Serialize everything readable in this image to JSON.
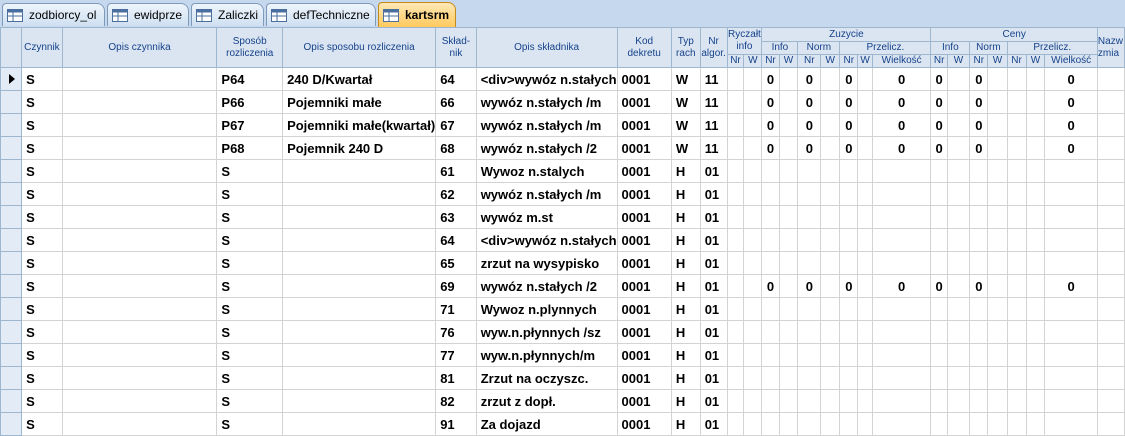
{
  "tabs": [
    {
      "label": "zodbiorcy_ol",
      "active": false
    },
    {
      "label": "ewidprze",
      "active": false
    },
    {
      "label": "Zaliczki",
      "active": false
    },
    {
      "label": "defTechniczne",
      "active": false
    },
    {
      "label": "kartsrm",
      "active": true
    }
  ],
  "headers": {
    "czynnik": "Czynnik",
    "opis_czynnika": "Opis  czynnika",
    "sposob": "Sposób rozliczenia",
    "opis_sposobu": "Opis sposobu rozliczenia",
    "skladnik": "Skład-nik",
    "opis_skladnika": "Opis składnika",
    "kod_dekretu": "Kod dekretu",
    "typ_rach": "Typ rach",
    "nr_algor": "Nr algor.",
    "ryczalt_info": "Ryczałt info",
    "zuzycie": "Zuzycie",
    "ceny": "Ceny",
    "info": "Info",
    "norm": "Norm",
    "przelicz": "Przelicz.",
    "nr": "Nr",
    "w": "W",
    "wielkosc": "Wielkość",
    "nazwa": "Nazw zmia"
  },
  "rows": [
    {
      "czynnik": "S",
      "sposob": "P64",
      "opis_sposobu": "240 D/Kwartał",
      "skladnik": "64",
      "opis_skladnika": "<div>wywóz n.stałych",
      "kod": "0001",
      "typ": "W",
      "nr": "11",
      "v1": "0",
      "v2": "0",
      "v3": "0",
      "v4": "0",
      "v5": "0",
      "v6": "0",
      "v7": "0"
    },
    {
      "czynnik": "S",
      "sposob": "P66",
      "opis_sposobu": "Pojemniki małe",
      "skladnik": "66",
      "opis_skladnika": "wywóz n.stałych /m",
      "kod": "0001",
      "typ": "W",
      "nr": "11",
      "v1": "0",
      "v2": "0",
      "v3": "0",
      "v4": "0",
      "v5": "0",
      "v6": "0",
      "v7": "0"
    },
    {
      "czynnik": "S",
      "sposob": "P67",
      "opis_sposobu": "Pojemniki małe(kwartał)",
      "skladnik": "67",
      "opis_skladnika": "wywóz n.stałych /m",
      "kod": "0001",
      "typ": "W",
      "nr": "11",
      "v1": "0",
      "v2": "0",
      "v3": "0",
      "v4": "0",
      "v5": "0",
      "v6": "0",
      "v7": "0"
    },
    {
      "czynnik": "S",
      "sposob": "P68",
      "opis_sposobu": "Pojemnik 240 D",
      "skladnik": "68",
      "opis_skladnika": "wywóz n.stałych /2",
      "kod": "0001",
      "typ": "W",
      "nr": "11",
      "v1": "0",
      "v2": "0",
      "v3": "0",
      "v4": "0",
      "v5": "0",
      "v6": "0",
      "v7": "0"
    },
    {
      "czynnik": "S",
      "sposob": "S",
      "opis_sposobu": "",
      "skladnik": "61",
      "opis_skladnika": "Wywoz n.stalych",
      "kod": "0001",
      "typ": "H",
      "nr": "01",
      "v1": "",
      "v2": "",
      "v3": "",
      "v4": "",
      "v5": "",
      "v6": "",
      "v7": ""
    },
    {
      "czynnik": "S",
      "sposob": "S",
      "opis_sposobu": "",
      "skladnik": "62",
      "opis_skladnika": "wywóz n.stałych /m",
      "kod": "0001",
      "typ": "H",
      "nr": "01",
      "v1": "",
      "v2": "",
      "v3": "",
      "v4": "",
      "v5": "",
      "v6": "",
      "v7": ""
    },
    {
      "czynnik": "S",
      "sposob": "S",
      "opis_sposobu": "",
      "skladnik": "63",
      "opis_skladnika": "wywóz m.st",
      "kod": "0001",
      "typ": "H",
      "nr": "01",
      "v1": "",
      "v2": "",
      "v3": "",
      "v4": "",
      "v5": "",
      "v6": "",
      "v7": ""
    },
    {
      "czynnik": "S",
      "sposob": "S",
      "opis_sposobu": "",
      "skladnik": "64",
      "opis_skladnika": "<div>wywóz n.stałych",
      "kod": "0001",
      "typ": "H",
      "nr": "01",
      "v1": "",
      "v2": "",
      "v3": "",
      "v4": "",
      "v5": "",
      "v6": "",
      "v7": ""
    },
    {
      "czynnik": "S",
      "sposob": "S",
      "opis_sposobu": "",
      "skladnik": "65",
      "opis_skladnika": "zrzut na wysypisko",
      "kod": "0001",
      "typ": "H",
      "nr": "01",
      "v1": "",
      "v2": "",
      "v3": "",
      "v4": "",
      "v5": "",
      "v6": "",
      "v7": ""
    },
    {
      "czynnik": "S",
      "sposob": "S",
      "opis_sposobu": "",
      "skladnik": "69",
      "opis_skladnika": "wywóz n.stałych /2",
      "kod": "0001",
      "typ": "H",
      "nr": "01",
      "v1": "0",
      "v2": "0",
      "v3": "0",
      "v4": "0",
      "v5": "0",
      "v6": "0",
      "v7": "0"
    },
    {
      "czynnik": "S",
      "sposob": "S",
      "opis_sposobu": "",
      "skladnik": "71",
      "opis_skladnika": "Wywoz n.plynnych",
      "kod": "0001",
      "typ": "H",
      "nr": "01",
      "v1": "",
      "v2": "",
      "v3": "",
      "v4": "",
      "v5": "",
      "v6": "",
      "v7": ""
    },
    {
      "czynnik": "S",
      "sposob": "S",
      "opis_sposobu": "",
      "skladnik": "76",
      "opis_skladnika": "wyw.n.płynnych /sz",
      "kod": "0001",
      "typ": "H",
      "nr": "01",
      "v1": "",
      "v2": "",
      "v3": "",
      "v4": "",
      "v5": "",
      "v6": "",
      "v7": ""
    },
    {
      "czynnik": "S",
      "sposob": "S",
      "opis_sposobu": "",
      "skladnik": "77",
      "opis_skladnika": "wyw.n.płynnych/m",
      "kod": "0001",
      "typ": "H",
      "nr": "01",
      "v1": "",
      "v2": "",
      "v3": "",
      "v4": "",
      "v5": "",
      "v6": "",
      "v7": ""
    },
    {
      "czynnik": "S",
      "sposob": "S",
      "opis_sposobu": "",
      "skladnik": "81",
      "opis_skladnika": "Zrzut na oczyszc.",
      "kod": "0001",
      "typ": "H",
      "nr": "01",
      "v1": "",
      "v2": "",
      "v3": "",
      "v4": "",
      "v5": "",
      "v6": "",
      "v7": ""
    },
    {
      "czynnik": "S",
      "sposob": "S",
      "opis_sposobu": "",
      "skladnik": "82",
      "opis_skladnika": "zrzut z dopł.",
      "kod": "0001",
      "typ": "H",
      "nr": "01",
      "v1": "",
      "v2": "",
      "v3": "",
      "v4": "",
      "v5": "",
      "v6": "",
      "v7": ""
    },
    {
      "czynnik": "S",
      "sposob": "S",
      "opis_sposobu": "",
      "skladnik": "91",
      "opis_skladnika": "Za dojazd",
      "kod": "0001",
      "typ": "H",
      "nr": "01",
      "v1": "",
      "v2": "",
      "v3": "",
      "v4": "",
      "v5": "",
      "v6": "",
      "v7": ""
    }
  ]
}
